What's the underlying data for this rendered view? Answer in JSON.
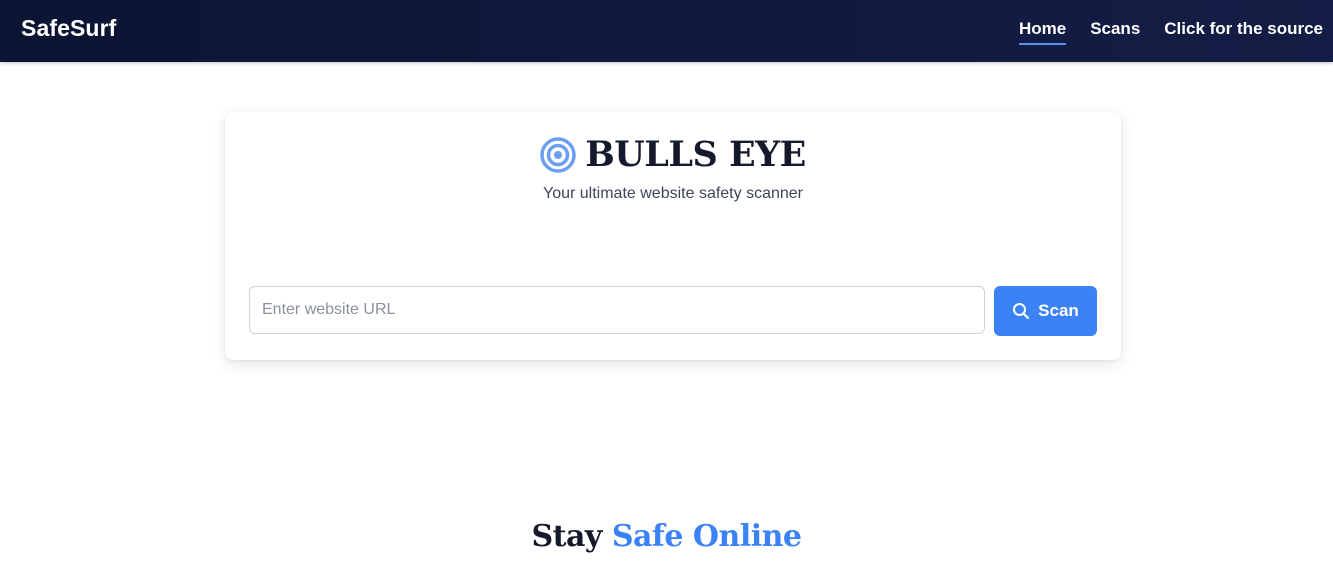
{
  "nav": {
    "brand": "SafeSurf",
    "links": [
      {
        "label": "Home",
        "active": true
      },
      {
        "label": "Scans",
        "active": false
      },
      {
        "label": "Click for the source",
        "active": false
      }
    ]
  },
  "hero": {
    "icon": "target-icon",
    "title": "BULLS EYE",
    "subtitle": "Your ultimate website safety scanner",
    "input_placeholder": "Enter website URL",
    "input_value": "",
    "scan_icon": "search-icon",
    "scan_label": "Scan"
  },
  "section": {
    "heading_part1": "Stay",
    "heading_part2": "Safe Online"
  },
  "colors": {
    "navbar": "#0c1433",
    "accent": "#3b82f6",
    "active_underline": "#5b8ff0",
    "icon": "#6b9ef0"
  }
}
